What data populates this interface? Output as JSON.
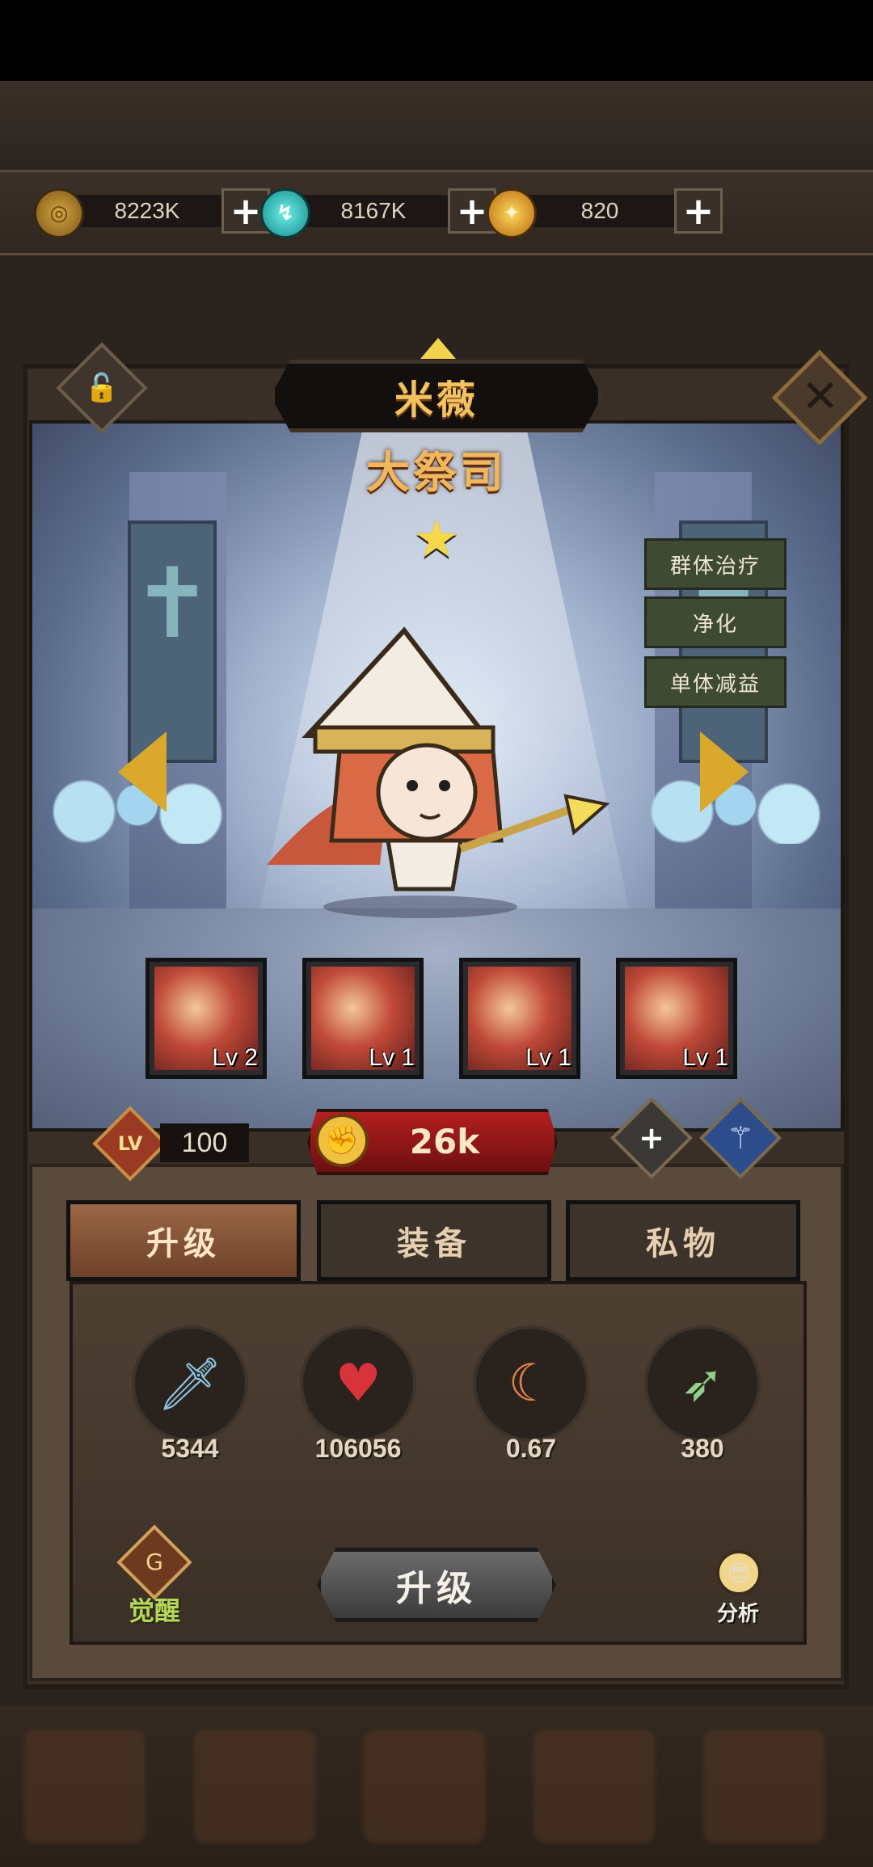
{
  "currency": [
    {
      "icon": "gold-coin-icon",
      "amount": "8223K",
      "plus": "+"
    },
    {
      "icon": "blue-gem-icon",
      "amount": "8167K",
      "plus": "+"
    },
    {
      "icon": "gold-orb-icon",
      "amount": "820",
      "plus": "+"
    }
  ],
  "hero": {
    "name": "米薇",
    "title": "大祭司",
    "stars": "★"
  },
  "tags": [
    "群体治疗",
    "净化",
    "单体减益"
  ],
  "skills": [
    {
      "level": "Lv 2"
    },
    {
      "level": "Lv 1"
    },
    {
      "level": "Lv 1"
    },
    {
      "level": "Lv 1"
    }
  ],
  "level": {
    "badge": "LV",
    "value": "100"
  },
  "power": {
    "value": "26k"
  },
  "buttons": {
    "plus": "+",
    "lock": "🔓",
    "close": "✕"
  },
  "tabs": [
    "升级",
    "装备",
    "私物"
  ],
  "stats": [
    {
      "icon": "sword-icon",
      "value": "5344"
    },
    {
      "icon": "heart-icon",
      "value": "106056"
    },
    {
      "icon": "crit-blade-icon",
      "value": "0.67"
    },
    {
      "icon": "arrow-icon",
      "value": "380"
    }
  ],
  "actions": {
    "upgrade": "升级",
    "awaken": "觉醒",
    "analyze": "分析"
  },
  "colors": {
    "accent_gold": "#f2b65c",
    "power_red": "#b31f1f",
    "tag_green": "#3f4a35"
  }
}
